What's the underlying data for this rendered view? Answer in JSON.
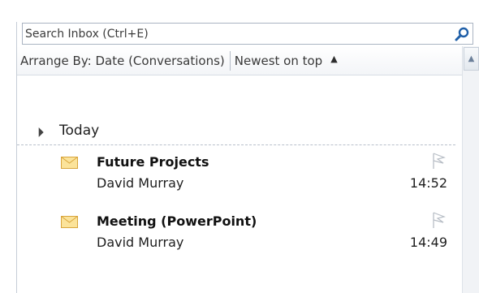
{
  "search": {
    "placeholder": "Search Inbox (Ctrl+E)",
    "icon": "search-icon"
  },
  "arrange": {
    "arrange_by": "Arrange By: Date (Conversations)",
    "sort_order": "Newest on top",
    "sort_arrow": "▲"
  },
  "group": {
    "label": "Today",
    "triangle": "◢"
  },
  "messages": [
    {
      "subject": "Future Projects",
      "sender": "David Murray",
      "time": "14:52",
      "icon": "envelope-icon",
      "flag": "flag-icon"
    },
    {
      "subject": "Meeting (PowerPoint)",
      "sender": "David Murray",
      "time": "14:49",
      "icon": "envelope-icon",
      "flag": "flag-icon"
    }
  ],
  "scrollbar": {
    "up_arrow": "▲"
  },
  "colors": {
    "envelope_fill": "#fbe39a",
    "envelope_stroke": "#d8a53c",
    "search_icon": "#1f5fa8",
    "flag_stroke": "#b8bec6"
  }
}
